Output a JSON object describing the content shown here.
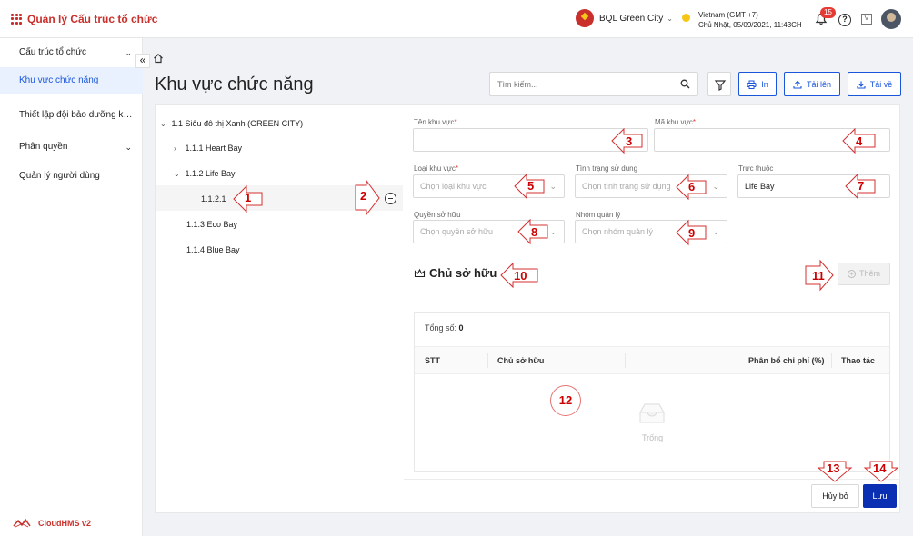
{
  "header": {
    "app_title": "Quản lý Cấu trúc tổ chức",
    "org_name": "BQL Green City",
    "timezone": "Vietnam (GMT +7)",
    "datetime": "Chủ Nhật, 05/09/2021, 11:43CH",
    "notification_count": "15",
    "help_label": "?",
    "box_label": "V"
  },
  "sidebar": {
    "items": [
      {
        "label": "Cấu trúc tổ chức",
        "chevron": "⌄"
      },
      {
        "label": "Khu vực chức năng",
        "chevron": ""
      },
      {
        "label": "Thiết lập đội bảo dưỡng khu vực",
        "chevron": ""
      },
      {
        "label": "Phân quyền",
        "chevron": "⌄"
      },
      {
        "label": "Quản lý người dùng",
        "chevron": ""
      }
    ],
    "collapse_label": "«",
    "brand": "CloudHMS v2"
  },
  "page": {
    "title": "Khu vực chức năng",
    "search_placeholder": "Tìm kiếm...",
    "print_label": "In",
    "upload_label": "Tải lên",
    "download_label": "Tải về"
  },
  "tree": {
    "root": "1.1 Siêu đô thị Xanh (GREEN CITY)",
    "n1": "1.1.1 Heart Bay",
    "n2": "1.1.2 Life Bay",
    "n2_child": "1.1.2.1",
    "n3": "1.1.3 Eco Bay",
    "n4": "1.1.4 Blue Bay",
    "expanded_arrow": "⌄",
    "collapsed_arrow": "›"
  },
  "form": {
    "name_label": "Tên khu vực",
    "code_label": "Mã khu vực",
    "type_label": "Loại khu vực",
    "type_placeholder": "Chọn loại khu vực",
    "status_label": "Tình trạng sử dụng",
    "status_placeholder": "Chọn tình trạng sử dụng",
    "parent_label": "Trực thuộc",
    "parent_value": "Life Bay",
    "ownership_label": "Quyền sở hữu",
    "ownership_placeholder": "Chọn quyền sở hữu",
    "group_label": "Nhóm quản lý",
    "group_placeholder": "Chọn nhóm quản lý",
    "required_mark": "*",
    "caret": "⌄"
  },
  "owners": {
    "title": "Chủ sở hữu",
    "add_label": "Thêm",
    "add_icon": "+",
    "total_label": "Tổng số:",
    "total_value": "0",
    "columns": [
      "STT",
      "Chủ sở hữu",
      "Phân bổ chi phí (%)",
      "Thao tác"
    ],
    "empty_text": "Trống"
  },
  "footer": {
    "cancel_label": "Hủy bỏ",
    "save_label": "Lưu"
  },
  "annotations": [
    "1",
    "2",
    "3",
    "4",
    "5",
    "6",
    "7",
    "8",
    "9",
    "10",
    "11",
    "12",
    "13",
    "14"
  ],
  "colors": {
    "brand_red": "#c9302c",
    "primary_blue": "#1a56db",
    "save_blue": "#0b2fb3",
    "annotation_red": "#c00000"
  }
}
